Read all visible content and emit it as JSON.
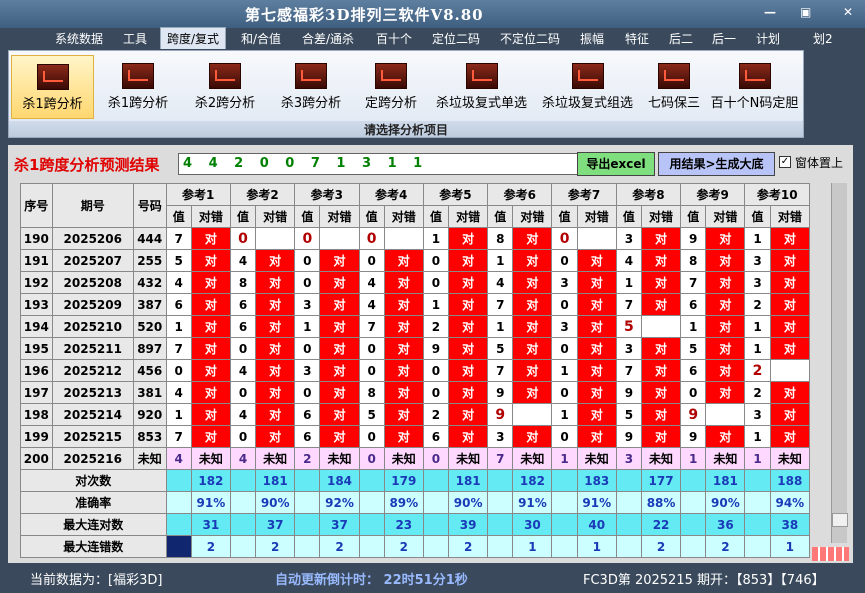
{
  "window": {
    "title": "第七感福彩3D排列三软件V8.80",
    "minimize": "—",
    "restore": "▣",
    "close": "✕"
  },
  "menu": [
    "系统数据",
    "工具",
    "跨度/复式",
    "和/合值",
    "合差/通杀",
    "百十个",
    "定位二码",
    "不定位二码",
    "振幅",
    "特征",
    "后二",
    "后一",
    "计划",
    "划2"
  ],
  "ribbon": {
    "buttons": [
      "杀1跨分析",
      "杀1跨分析",
      "杀2跨分析",
      "杀3跨分析",
      "定跨分析",
      "杀垃圾复式单选",
      "杀垃圾复式组选",
      "七码保三",
      "百十个N码定胆"
    ],
    "footer": "请选择分析项目",
    "icon": "chart-icon"
  },
  "panel": {
    "caption": "杀1跨度分析预测结果",
    "result": "4 4 2 0 0 7 1 3 1 1",
    "export_label": "导出excel",
    "use_label": "用结果>生成大底",
    "checkbox_mark": "✓",
    "topmost_label": "窗体置上"
  },
  "table": {
    "headers": {
      "seq": "序号",
      "period": "期号",
      "code": "号码",
      "refs": [
        "参考1",
        "参考2",
        "参考3",
        "参考4",
        "参考5",
        "参考6",
        "参考7",
        "参考8",
        "参考9",
        "参考10"
      ],
      "val": "值",
      "dc": "对错"
    },
    "rows": [
      {
        "seq": "190",
        "period": "2025206",
        "code": "444",
        "cells": [
          [
            "7",
            "对"
          ],
          [
            "0",
            ""
          ],
          [
            "0",
            ""
          ],
          [
            "0",
            ""
          ],
          [
            "1",
            "对"
          ],
          [
            "8",
            "对"
          ],
          [
            "0",
            ""
          ],
          [
            "3",
            "对"
          ],
          [
            "9",
            "对"
          ],
          [
            "1",
            "对"
          ]
        ]
      },
      {
        "seq": "191",
        "period": "2025207",
        "code": "255",
        "cells": [
          [
            "5",
            "对"
          ],
          [
            "4",
            "对"
          ],
          [
            "0",
            "对"
          ],
          [
            "0",
            "对"
          ],
          [
            "0",
            "对"
          ],
          [
            "1",
            "对"
          ],
          [
            "0",
            "对"
          ],
          [
            "4",
            "对"
          ],
          [
            "8",
            "对"
          ],
          [
            "3",
            "对"
          ]
        ]
      },
      {
        "seq": "192",
        "period": "2025208",
        "code": "432",
        "cells": [
          [
            "4",
            "对"
          ],
          [
            "8",
            "对"
          ],
          [
            "0",
            "对"
          ],
          [
            "4",
            "对"
          ],
          [
            "0",
            "对"
          ],
          [
            "4",
            "对"
          ],
          [
            "3",
            "对"
          ],
          [
            "1",
            "对"
          ],
          [
            "7",
            "对"
          ],
          [
            "3",
            "对"
          ]
        ]
      },
      {
        "seq": "193",
        "period": "2025209",
        "code": "387",
        "cells": [
          [
            "6",
            "对"
          ],
          [
            "6",
            "对"
          ],
          [
            "3",
            "对"
          ],
          [
            "4",
            "对"
          ],
          [
            "1",
            "对"
          ],
          [
            "7",
            "对"
          ],
          [
            "0",
            "对"
          ],
          [
            "7",
            "对"
          ],
          [
            "6",
            "对"
          ],
          [
            "2",
            "对"
          ]
        ]
      },
      {
        "seq": "194",
        "period": "2025210",
        "code": "520",
        "cells": [
          [
            "1",
            "对"
          ],
          [
            "6",
            "对"
          ],
          [
            "1",
            "对"
          ],
          [
            "7",
            "对"
          ],
          [
            "2",
            "对"
          ],
          [
            "1",
            "对"
          ],
          [
            "3",
            "对"
          ],
          [
            "5",
            ""
          ],
          [
            "1",
            "对"
          ],
          [
            "1",
            "对"
          ]
        ]
      },
      {
        "seq": "195",
        "period": "2025211",
        "code": "897",
        "cells": [
          [
            "7",
            "对"
          ],
          [
            "0",
            "对"
          ],
          [
            "0",
            "对"
          ],
          [
            "0",
            "对"
          ],
          [
            "9",
            "对"
          ],
          [
            "5",
            "对"
          ],
          [
            "0",
            "对"
          ],
          [
            "3",
            "对"
          ],
          [
            "5",
            "对"
          ],
          [
            "1",
            "对"
          ]
        ]
      },
      {
        "seq": "196",
        "period": "2025212",
        "code": "456",
        "cells": [
          [
            "0",
            "对"
          ],
          [
            "4",
            "对"
          ],
          [
            "3",
            "对"
          ],
          [
            "0",
            "对"
          ],
          [
            "0",
            "对"
          ],
          [
            "7",
            "对"
          ],
          [
            "1",
            "对"
          ],
          [
            "7",
            "对"
          ],
          [
            "6",
            "对"
          ],
          [
            "2",
            ""
          ]
        ]
      },
      {
        "seq": "197",
        "period": "2025213",
        "code": "381",
        "cells": [
          [
            "4",
            "对"
          ],
          [
            "0",
            "对"
          ],
          [
            "0",
            "对"
          ],
          [
            "8",
            "对"
          ],
          [
            "0",
            "对"
          ],
          [
            "9",
            "对"
          ],
          [
            "0",
            "对"
          ],
          [
            "9",
            "对"
          ],
          [
            "0",
            "对"
          ],
          [
            "2",
            "对"
          ]
        ]
      },
      {
        "seq": "198",
        "period": "2025214",
        "code": "920",
        "cells": [
          [
            "1",
            "对"
          ],
          [
            "4",
            "对"
          ],
          [
            "6",
            "对"
          ],
          [
            "5",
            "对"
          ],
          [
            "2",
            "对"
          ],
          [
            "9",
            ""
          ],
          [
            "1",
            "对"
          ],
          [
            "5",
            "对"
          ],
          [
            "9",
            ""
          ],
          [
            "3",
            "对"
          ]
        ]
      },
      {
        "seq": "199",
        "period": "2025215",
        "code": "853",
        "cells": [
          [
            "7",
            "对"
          ],
          [
            "0",
            "对"
          ],
          [
            "6",
            "对"
          ],
          [
            "0",
            "对"
          ],
          [
            "6",
            "对"
          ],
          [
            "3",
            "对"
          ],
          [
            "0",
            "对"
          ],
          [
            "9",
            "对"
          ],
          [
            "9",
            "对"
          ],
          [
            "1",
            "对"
          ]
        ]
      }
    ],
    "last_row": {
      "seq": "200",
      "period": "2025216",
      "code": "未知",
      "cells": [
        [
          "4",
          "未知"
        ],
        [
          "4",
          "未知"
        ],
        [
          "2",
          "未知"
        ],
        [
          "0",
          "未知"
        ],
        [
          "0",
          "未知"
        ],
        [
          "7",
          "未知"
        ],
        [
          "1",
          "未知"
        ],
        [
          "3",
          "未知"
        ],
        [
          "1",
          "未知"
        ],
        [
          "1",
          "未知"
        ]
      ]
    },
    "stats": [
      {
        "label": "对次数",
        "values": [
          "182",
          "181",
          "184",
          "179",
          "181",
          "182",
          "183",
          "177",
          "181",
          "188"
        ]
      },
      {
        "label": "准确率",
        "values": [
          "91%",
          "90%",
          "92%",
          "89%",
          "90%",
          "91%",
          "91%",
          "88%",
          "90%",
          "94%"
        ]
      },
      {
        "label": "最大连对数",
        "values": [
          "31",
          "37",
          "37",
          "23",
          "39",
          "30",
          "40",
          "22",
          "36",
          "38"
        ]
      },
      {
        "label": "最大连错数",
        "values": [
          "2",
          "2",
          "2",
          "2",
          "2",
          "1",
          "1",
          "2",
          "2",
          "1"
        ]
      }
    ]
  },
  "status": {
    "source": "当前数据为：[福彩3D]",
    "countdown": "自动更新倒计时： 22时51分1秒",
    "latest": "FC3D第 2025215 期开：【853】【746】"
  }
}
